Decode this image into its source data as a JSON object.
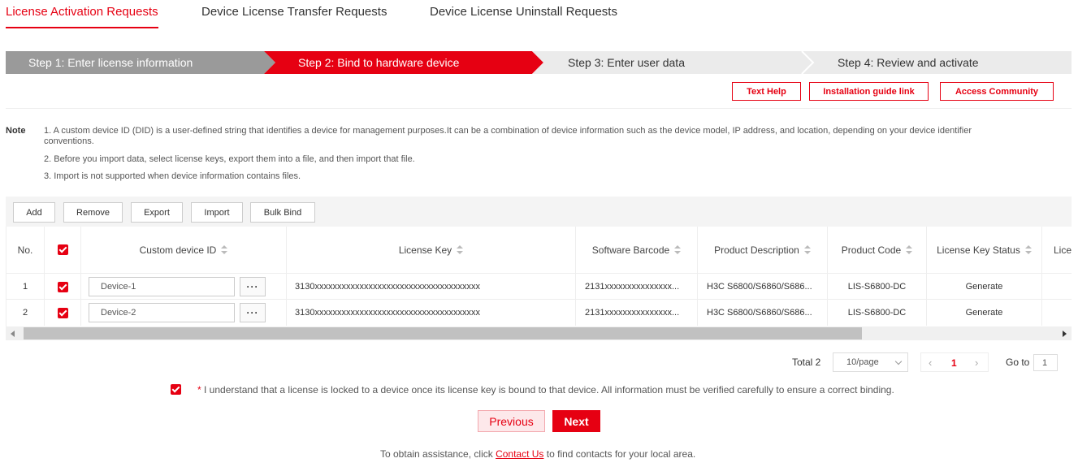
{
  "tabs": [
    {
      "label": "License Activation Requests",
      "active": true
    },
    {
      "label": "Device License Transfer Requests",
      "active": false
    },
    {
      "label": "Device License Uninstall Requests",
      "active": false
    }
  ],
  "steps": [
    {
      "label": "Step 1: Enter license information",
      "state": "done"
    },
    {
      "label": "Step 2: Bind to hardware device",
      "state": "active"
    },
    {
      "label": "Step 3: Enter user data",
      "state": "pending"
    },
    {
      "label": "Step 4: Review and activate",
      "state": "pending"
    }
  ],
  "help": {
    "text_help": "Text Help",
    "install_guide": "Installation guide link",
    "community": "Access Community"
  },
  "note": {
    "title": "Note",
    "line1a": "1. A custom device ID (DID) is a user-defined string that identifies a device for management purposes.It can be a combination of device information such as the device model, IP address, and location, depending on your device identifier",
    "line1b": "conventions.",
    "line2": "2. Before you import data, select license keys, export them into a file, and then import that file.",
    "line3": "3. Import is not supported when device information contains files."
  },
  "toolbar": {
    "add": "Add",
    "remove": "Remove",
    "export": "Export",
    "import": "Import",
    "bulk_bind": "Bulk Bind"
  },
  "table": {
    "headers": {
      "no": "No.",
      "did": "Custom device ID",
      "key": "License Key",
      "barcode": "Software Barcode",
      "desc": "Product Description",
      "code": "Product Code",
      "status": "License Key Status",
      "more": "Licen"
    },
    "rows": [
      {
        "no": "1",
        "did": "Device-1",
        "dots": "···",
        "key": "3130xxxxxxxxxxxxxxxxxxxxxxxxxxxxxxxxxxxxx",
        "barcode": "2131xxxxxxxxxxxxxxx...",
        "desc": "H3C S6800/S6860/S686...",
        "code": "LIS-S6800-DC",
        "status": "Generate"
      },
      {
        "no": "2",
        "did": "Device-2",
        "dots": "···",
        "key": "3130xxxxxxxxxxxxxxxxxxxxxxxxxxxxxxxxxxxxx",
        "barcode": "2131xxxxxxxxxxxxxxx...",
        "desc": "H3C S6800/S6860/S686...",
        "code": "LIS-S6800-DC",
        "status": "Generate"
      }
    ]
  },
  "pagination": {
    "total": "Total 2",
    "per_page": "10/page",
    "prev": "‹",
    "current": "1",
    "next": "›",
    "goto_label": "Go to",
    "goto_value": "1"
  },
  "agreement": {
    "star": "*",
    "text": "I understand that a license is locked to a device once its license key is bound to that device. All information must be verified carefully to ensure a correct binding."
  },
  "buttons": {
    "previous": "Previous",
    "next": "Next"
  },
  "footer": {
    "pre": "To obtain assistance, click",
    "link": "Contact Us",
    "post": "to find contacts for your local area."
  },
  "colors": {
    "accent": "#e60012",
    "step_done": "#9a9a9a",
    "step_pending": "#ebebeb"
  }
}
